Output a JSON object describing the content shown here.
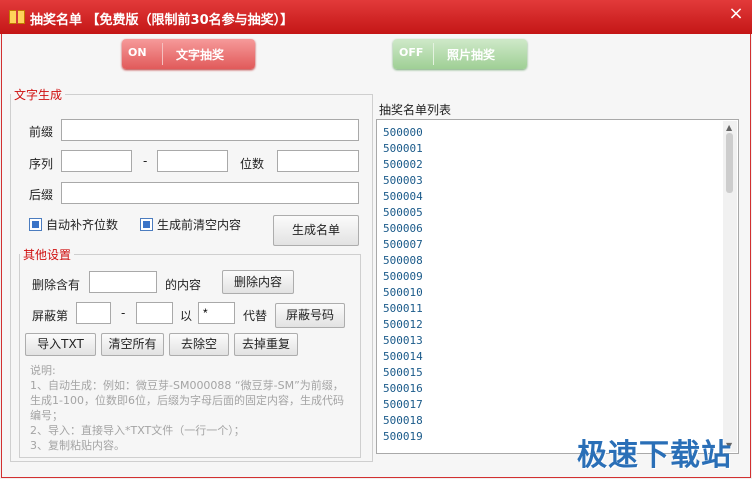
{
  "window": {
    "title": "抽奖名单  【免费版（限制前30名参与抽奖）】",
    "close_glyph": "×",
    "gift_icon": "gift-icon",
    "close_icon": "close-icon"
  },
  "mode_toggles": {
    "text": {
      "state": "ON",
      "label": "文字抽奖"
    },
    "photo": {
      "state": "OFF",
      "label": "照片抽奖"
    }
  },
  "text_gen": {
    "legend": "文字生成",
    "prefix_label": "前缀",
    "prefix_value": "",
    "seq_label": "序列",
    "seq_from": "",
    "seq_dash": "-",
    "seq_to": "",
    "digits_label": "位数",
    "digits_value": "",
    "suffix_label": "后缀",
    "suffix_value": "",
    "auto_pad_label": "自动补齐位数",
    "auto_pad_checked": true,
    "clear_before_label": "生成前清空内容",
    "clear_before_checked": true,
    "generate_button": "生成名单"
  },
  "other": {
    "legend": "其他设置",
    "delete_label_pre": "删除含有",
    "delete_value": "",
    "delete_label_post": "的内容",
    "delete_button": "删除内容",
    "mask_label_pre": "屏蔽第",
    "mask_from": "",
    "mask_dash": "-",
    "mask_to": "",
    "mask_label_with": "以",
    "mask_char": "*",
    "mask_label_replace": "代替",
    "mask_button": "屏蔽号码",
    "import_button": "导入TXT",
    "clear_all_button": "清空所有",
    "remove_space_button": "去除空",
    "remove_dup_button": "去掉重复"
  },
  "hint": {
    "title": "说明:",
    "line1": "1、自动生成：例如：微豆芽-SM000088  “微豆芽-SM”为前缀，生成1-100，位数即6位，后缀为字母后面的固定内容，生成代码编号；",
    "line2": "2、导入：直接导入*TXT文件（一行一个）；",
    "line3": "3、复制粘贴内容。"
  },
  "list": {
    "title": "抽奖名单列表",
    "items": [
      "500000",
      "500001",
      "500002",
      "500003",
      "500004",
      "500005",
      "500006",
      "500007",
      "500008",
      "500009",
      "500010",
      "500011",
      "500012",
      "500013",
      "500014",
      "500015",
      "500016",
      "500017",
      "500018",
      "500019"
    ]
  },
  "watermark": "极速下载站",
  "colors": {
    "title_bar": "#d42222",
    "on_toggle": "#e96b6b",
    "off_toggle": "#a9d6a0",
    "legend_text": "#d01010",
    "list_text": "#1a5a8a",
    "watermark": "#2a6fb7"
  }
}
